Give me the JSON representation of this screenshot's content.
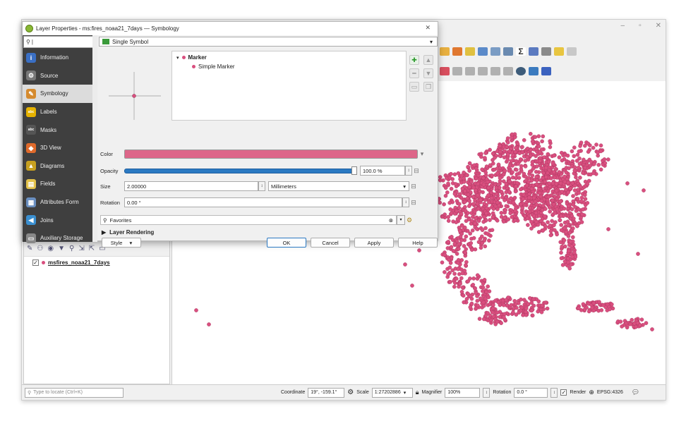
{
  "window": {
    "min": "–",
    "restore": "▫",
    "close": "✕"
  },
  "dialog": {
    "title": "Layer Properties - ms:fires_noaa21_7days — Symbology",
    "close": "✕",
    "search": "|",
    "nav": [
      {
        "label": "Information",
        "icon": "i",
        "color": "#3a6fc4"
      },
      {
        "label": "Source",
        "icon": "⚙",
        "color": "#777"
      },
      {
        "label": "Symbology",
        "icon": "✎",
        "color": "#d58a2e"
      },
      {
        "label": "Labels",
        "icon": "abc",
        "color": "#e6b200"
      },
      {
        "label": "Masks",
        "icon": "abc",
        "color": "#555"
      },
      {
        "label": "3D View",
        "icon": "◆",
        "color": "#e06a2b"
      },
      {
        "label": "Diagrams",
        "icon": "▲",
        "color": "#c7a020"
      },
      {
        "label": "Fields",
        "icon": "▤",
        "color": "#e3c24a"
      },
      {
        "label": "Attributes Form",
        "icon": "▦",
        "color": "#6a8fc0"
      },
      {
        "label": "Joins",
        "icon": "◀",
        "color": "#3a8fd0"
      },
      {
        "label": "Auxiliary Storage",
        "icon": "▭",
        "color": "#888"
      }
    ],
    "renderer": "Single Symbol",
    "tree": {
      "marker": "Marker",
      "simple": "Simple Marker"
    },
    "color_label": "Color",
    "opacity_label": "Opacity",
    "opacity_value": "100.0 %",
    "opacity_fraction": 1.0,
    "size_label": "Size",
    "size_value": "2.00000",
    "size_unit": "Millimeters",
    "rotation_label": "Rotation",
    "rotation_value": "0.00 °",
    "favorites": "Favorites",
    "layer_rendering": "Layer Rendering",
    "style_button": "Style",
    "ok": "OK",
    "cancel": "Cancel",
    "apply": "Apply",
    "help": "Help",
    "symbol_color": "#dd6689"
  },
  "layers": {
    "name": "msfires_noaa21_7days",
    "checked": "✓"
  },
  "status": {
    "locate_placeholder": "Type to locate (Ctrl+K)",
    "coordinate_label": "Coordinate",
    "coordinate_value": "19°, -159.1°",
    "scale_label": "Scale",
    "scale_value": "1:27202886",
    "magnifier_label": "Magnifier",
    "magnifier_value": "100%",
    "rotation_label": "Rotation",
    "rotation_value": "0.0 °",
    "render_label": "Render",
    "crs": "EPSG:4326"
  },
  "colors": {
    "points": "#d94f7f",
    "accent": "#2b79c2"
  }
}
